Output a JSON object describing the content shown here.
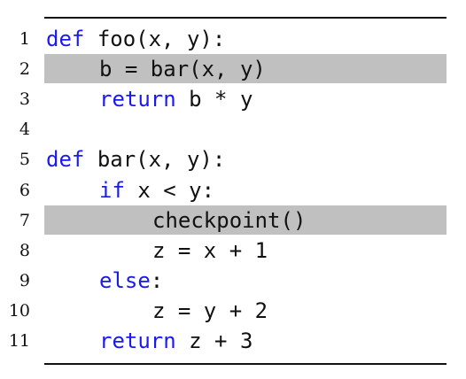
{
  "listing": {
    "lines": [
      {
        "number": "1",
        "indent": 0,
        "keyword": "def",
        "text": "foo(x, y):",
        "highlighted": false
      },
      {
        "number": "2",
        "indent": 1,
        "keyword": "",
        "text": "b = bar(x, y)",
        "highlighted": true
      },
      {
        "number": "3",
        "indent": 1,
        "keyword": "return",
        "text": "b * y",
        "highlighted": false
      },
      {
        "number": "4",
        "indent": 0,
        "keyword": "",
        "text": "",
        "highlighted": false
      },
      {
        "number": "5",
        "indent": 0,
        "keyword": "def",
        "text": "bar(x, y):",
        "highlighted": false
      },
      {
        "number": "6",
        "indent": 1,
        "keyword": "if",
        "text": "x < y:",
        "highlighted": false
      },
      {
        "number": "7",
        "indent": 2,
        "keyword": "",
        "text": "checkpoint()",
        "highlighted": true
      },
      {
        "number": "8",
        "indent": 2,
        "keyword": "",
        "text": "z = x + 1",
        "highlighted": false
      },
      {
        "number": "9",
        "indent": 1,
        "keyword": "else",
        "text": ":",
        "highlighted": false
      },
      {
        "number": "10",
        "indent": 2,
        "keyword": "",
        "text": "z = y + 2",
        "highlighted": false
      },
      {
        "number": "11",
        "indent": 1,
        "keyword": "return",
        "text": "z + 3",
        "highlighted": false
      }
    ]
  },
  "colors": {
    "keyword": "#1a1af0",
    "highlight": "#c0c0c0",
    "text": "#111111"
  }
}
